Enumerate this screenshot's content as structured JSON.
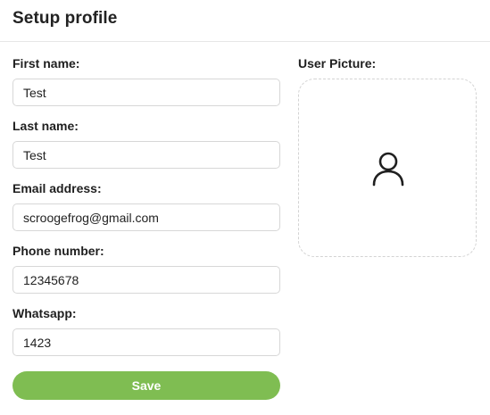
{
  "header": {
    "title": "Setup profile"
  },
  "form": {
    "first_name": {
      "label": "First name:",
      "value": "Test"
    },
    "last_name": {
      "label": "Last name:",
      "value": "Test"
    },
    "email": {
      "label": "Email address:",
      "value": "scroogefrog@gmail.com"
    },
    "phone": {
      "label": "Phone number:",
      "value": "12345678"
    },
    "whatsapp": {
      "label": "Whatsapp:",
      "value": "1423"
    },
    "save_label": "Save"
  },
  "picture": {
    "label": "User Picture:",
    "icon": "user-icon"
  },
  "colors": {
    "accent": "#7fbd52",
    "border": "#d7d7d7",
    "text": "#1f1f1f"
  }
}
